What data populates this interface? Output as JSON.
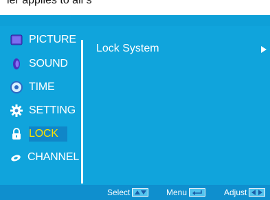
{
  "top_caption": "ler applies to all s",
  "menu": {
    "items": [
      {
        "label": "PICTURE",
        "icon": "picture-icon",
        "selected": false
      },
      {
        "label": "SOUND",
        "icon": "sound-icon",
        "selected": false
      },
      {
        "label": "TIME",
        "icon": "time-icon",
        "selected": false
      },
      {
        "label": "SETTING",
        "icon": "setting-gear-icon",
        "selected": false
      },
      {
        "label": "LOCK",
        "icon": "lock-icon",
        "selected": true
      },
      {
        "label": "CHANNEL",
        "icon": "channel-icon",
        "selected": false
      }
    ]
  },
  "content": {
    "rows": [
      {
        "label": "Lock System",
        "icon": "right-arrow-icon"
      }
    ]
  },
  "footer": {
    "select_label": "Select",
    "menu_label": "Menu",
    "adjust_label": "Adjust"
  },
  "colors": {
    "background": "#10a4dc",
    "footer": "#0f8fce",
    "selected_text": "#ffe400",
    "text": "#ffffff"
  }
}
